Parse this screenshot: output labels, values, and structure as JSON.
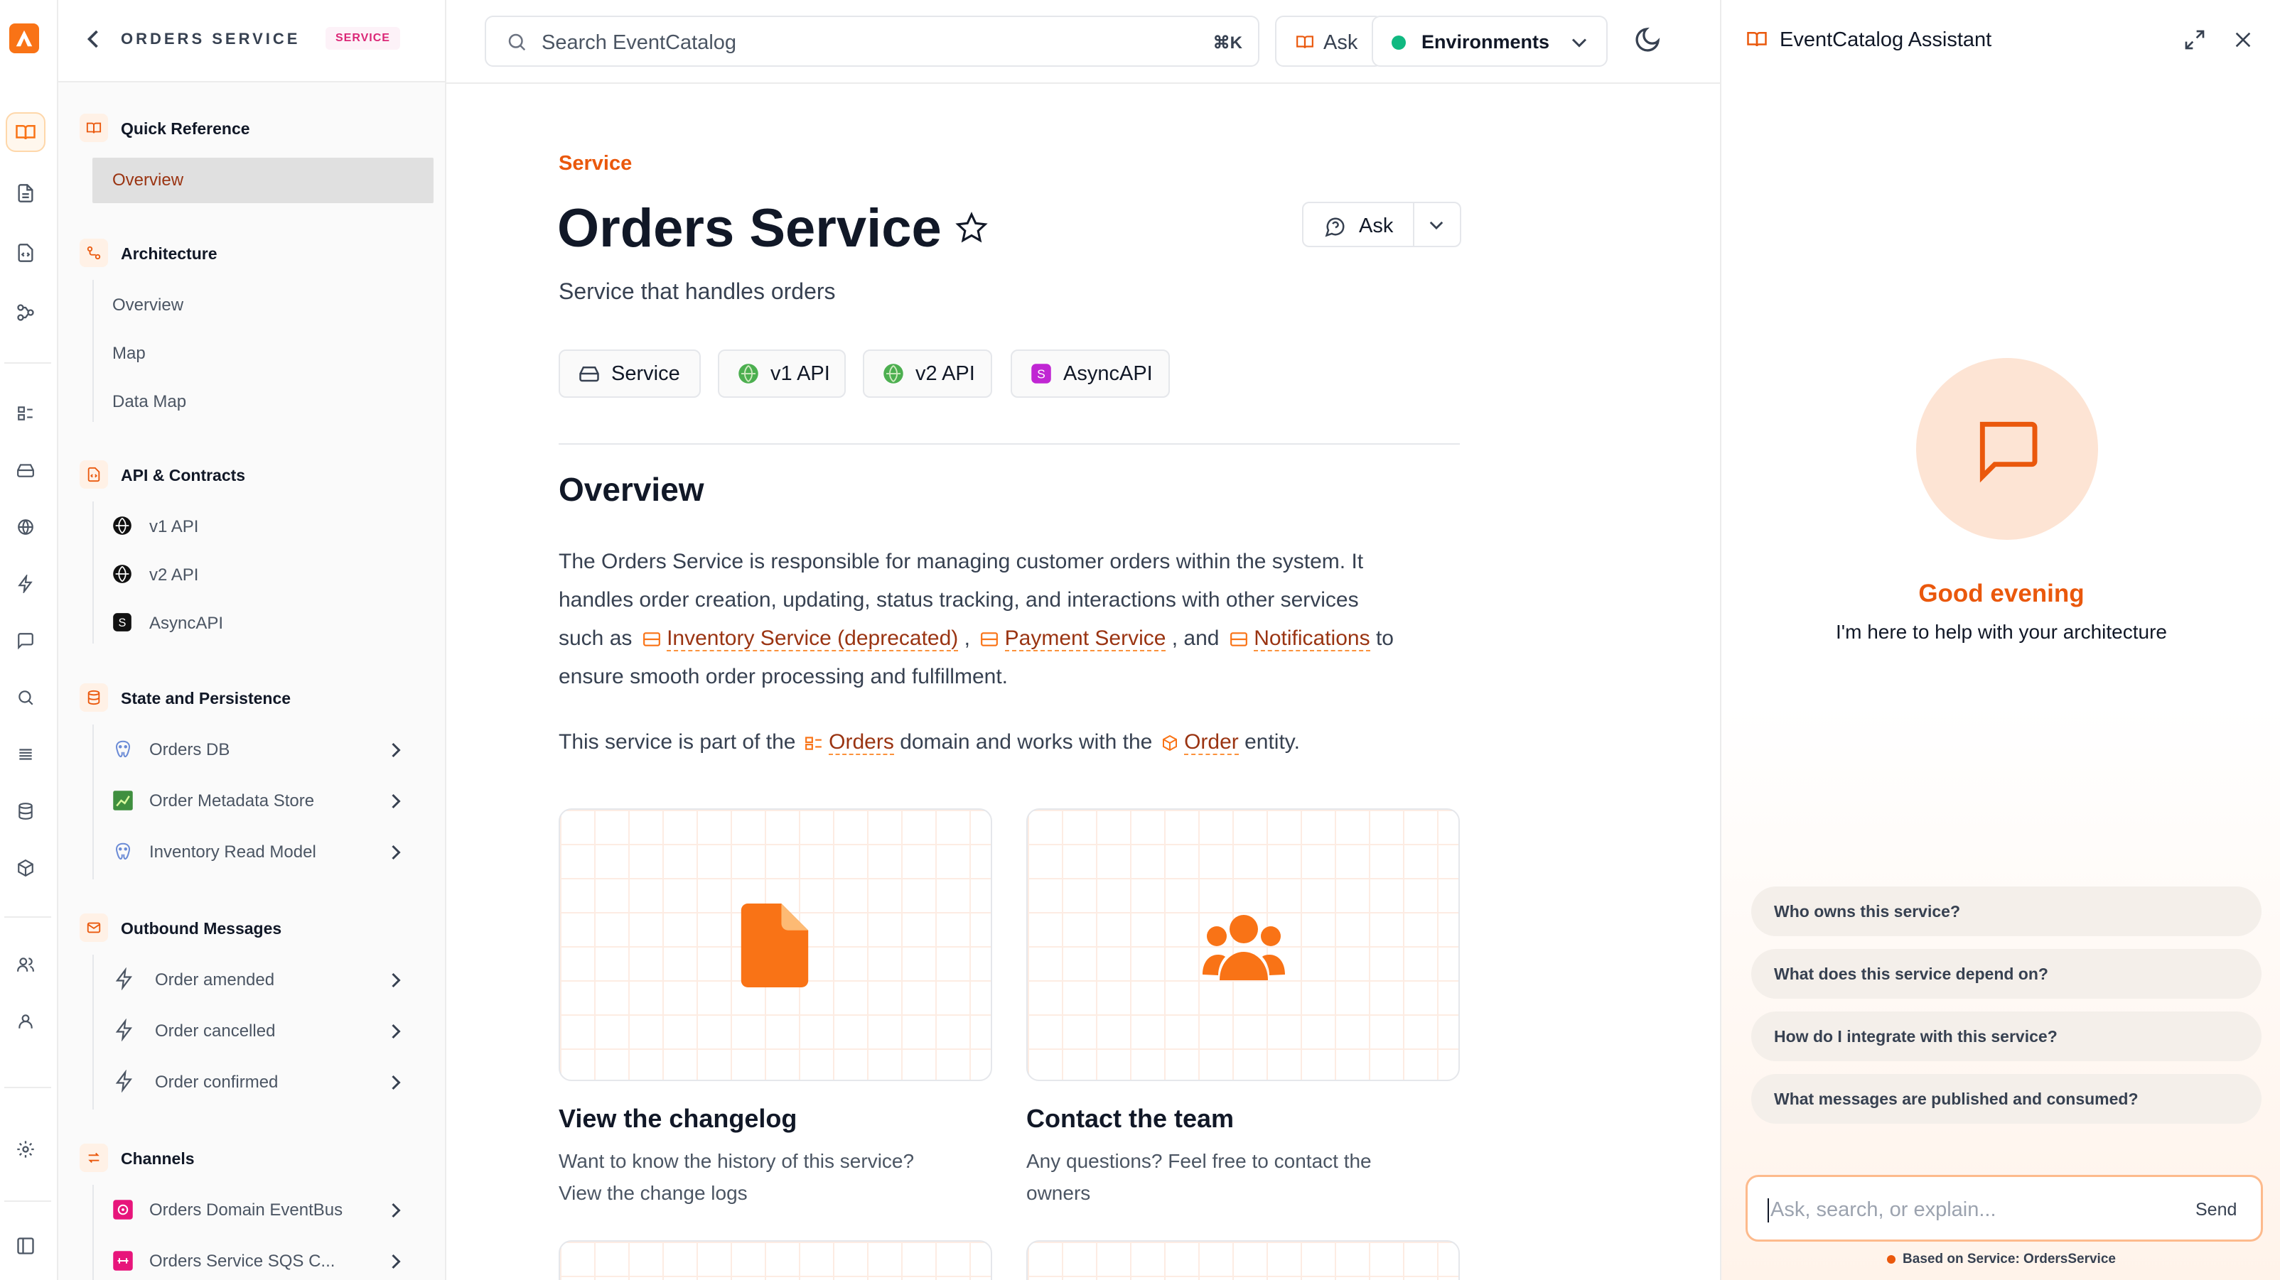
{
  "sidebar": {
    "title": "ORDERS SERVICE",
    "badge": "SERVICE",
    "sections": {
      "quick_reference": {
        "title": "Quick Reference",
        "items": [
          "Overview"
        ]
      },
      "architecture": {
        "title": "Architecture",
        "items": [
          "Overview",
          "Map",
          "Data Map"
        ]
      },
      "api_contracts": {
        "title": "API & Contracts",
        "items": [
          "v1 API",
          "v2 API",
          "AsyncAPI"
        ]
      },
      "state": {
        "title": "State and Persistence",
        "items": [
          "Orders DB",
          "Order Metadata Store",
          "Inventory Read Model"
        ]
      },
      "outbound": {
        "title": "Outbound Messages",
        "items": [
          "Order amended",
          "Order cancelled",
          "Order confirmed"
        ]
      },
      "channels": {
        "title": "Channels",
        "items": [
          "Orders Domain EventBus",
          "Orders Service SQS C..."
        ]
      }
    }
  },
  "topbar": {
    "search_placeholder": "Search EventCatalog",
    "shortcut": "⌘K",
    "ask_label": "Ask",
    "environments_label": "Environments"
  },
  "main": {
    "eyebrow": "Service",
    "title": "Orders Service",
    "summary": "Service that handles orders",
    "ask_button": "Ask",
    "badges": [
      "Service",
      "v1 API",
      "v2 API",
      "AsyncAPI"
    ],
    "overview_heading": "Overview",
    "p1": {
      "t1": "The Orders Service is responsible for managing customer orders within the system. It",
      "t2": "handles order creation, updating, status tracking, and interactions with other services",
      "t3": "such as",
      "link1": "Inventory Service (deprecated)",
      "sep1": ",",
      "link2": "Payment Service",
      "sep2": ", and",
      "link3": "Notifications",
      "t4": "to",
      "t5": "ensure smooth order processing and fulfillment."
    },
    "p2": {
      "t1": "This service is part of the",
      "link1": "Orders",
      "t2": "domain and works with the",
      "link2": "Order",
      "t3": "entity."
    },
    "cards": [
      {
        "title": "View the changelog",
        "line1": "Want to know the history of this service?",
        "line2": "View the change logs",
        "icon": "document-icon"
      },
      {
        "title": "Contact the team",
        "line1": "Any questions? Feel free to contact the",
        "line2": "owners",
        "icon": "users-icon"
      }
    ]
  },
  "assistant": {
    "title": "EventCatalog Assistant",
    "greeting": "Good evening",
    "subtitle": "I'm here to help with your architecture",
    "suggestions": [
      "Who owns this service?",
      "What does this service depend on?",
      "How do I integrate with this service?",
      "What messages are published and consumed?"
    ],
    "input_placeholder": "Ask, search, or explain...",
    "send_label": "Send",
    "context_note": "Based on Service: OrdersService"
  },
  "colors": {
    "accent": "#f97316",
    "accent_dark": "#c2410c",
    "link": "#9a3412",
    "env_dot": "#10b981"
  }
}
